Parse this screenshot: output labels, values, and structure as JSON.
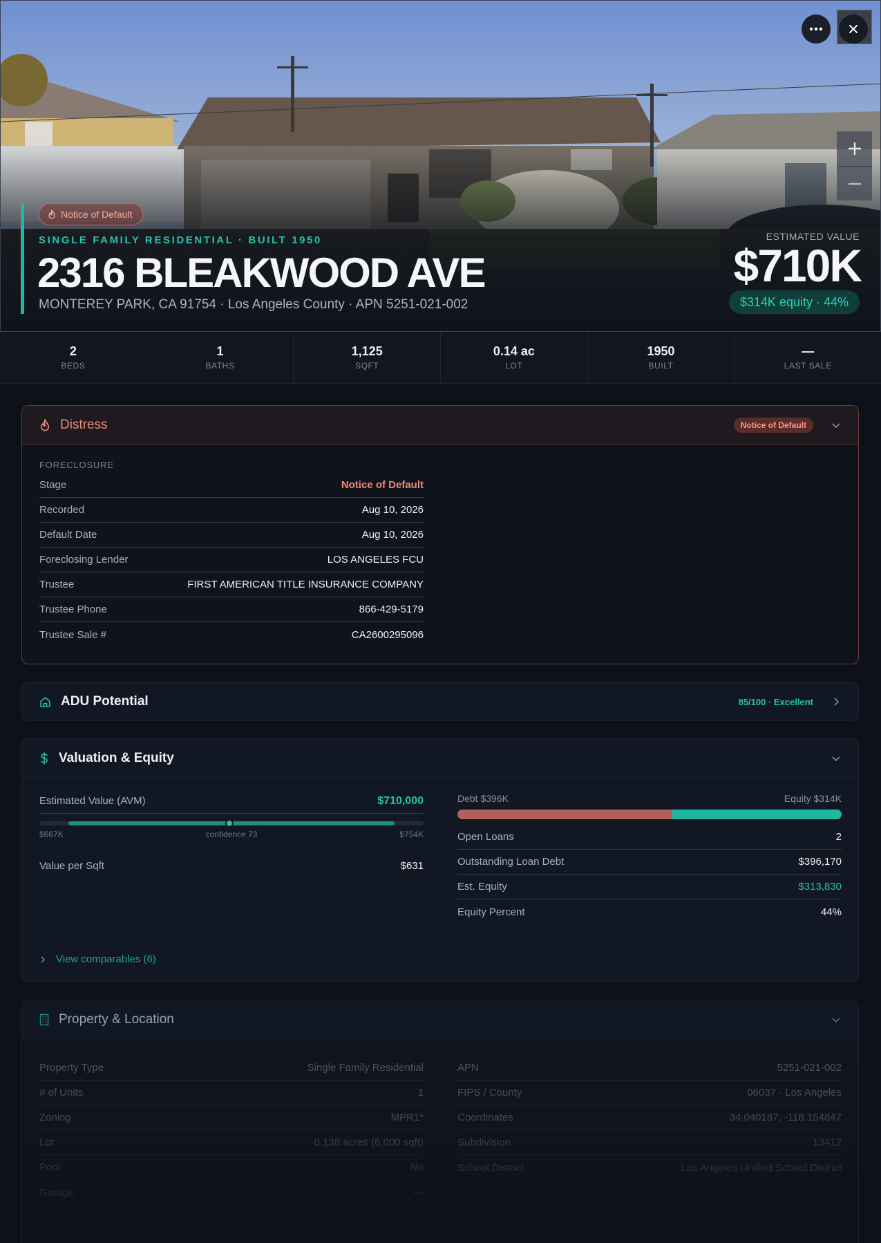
{
  "hero": {
    "badge": "Notice of Default",
    "subtitle": "SINGLE FAMILY RESIDENTIAL · BUILT 1950",
    "address": "2316 BLEAKWOOD AVE",
    "location": "MONTEREY PARK, CA 91754 · Los Angeles County · APN 5251-021-002",
    "estimated_label": "ESTIMATED VALUE",
    "estimated_value": "$710K",
    "equity_pill": "$314K equity · 44%"
  },
  "icons": {
    "more": "more-horizontal-icon",
    "close": "close-icon",
    "zoom_in": "plus-icon",
    "zoom_out": "minus-icon",
    "distress": "flame-icon",
    "adu": "home-icon",
    "valuation": "dollar-icon",
    "property": "building-icon"
  },
  "stats": [
    {
      "value": "2",
      "label": "BEDS"
    },
    {
      "value": "1",
      "label": "BATHS"
    },
    {
      "value": "1,125",
      "label": "SQFT"
    },
    {
      "value": "0.14 ac",
      "label": "LOT"
    },
    {
      "value": "1950",
      "label": "BUILT"
    },
    {
      "value": "—",
      "label": "LAST SALE"
    }
  ],
  "distress": {
    "title": "Distress",
    "badge": "Notice of Default",
    "section": "FORECLOSURE",
    "rows": [
      {
        "k": "Stage",
        "v": "Notice of Default"
      },
      {
        "k": "Recorded",
        "v": "Aug 10, 2026"
      },
      {
        "k": "Default Date",
        "v": "Aug 10, 2026"
      },
      {
        "k": "Foreclosing Lender",
        "v": "LOS ANGELES FCU"
      },
      {
        "k": "Trustee",
        "v": "FIRST AMERICAN TITLE INSURANCE COMPANY"
      },
      {
        "k": "Trustee Phone",
        "v": "866-429-5179"
      },
      {
        "k": "Trustee Sale #",
        "v": "CA2600295096"
      }
    ]
  },
  "adu": {
    "title": "ADU Potential",
    "score": "85/100 · Excellent"
  },
  "valuation": {
    "title": "Valuation & Equity",
    "avm_label": "Estimated Value (AVM)",
    "avm_value": "$710,000",
    "range_low": "$667K",
    "range_high": "$754K",
    "confidence": "confidence 73",
    "range_low_num": 667,
    "range_high_num": 754,
    "avm_num": 710,
    "per_sqft_label": "Value per Sqft",
    "per_sqft_value": "$631",
    "debt_label": "Debt $396K",
    "equity_label": "Equity $314K",
    "debt_share": 0.56,
    "rows": [
      {
        "k": "Open Loans",
        "v": "2"
      },
      {
        "k": "Outstanding Loan Debt",
        "v": "$396,170"
      },
      {
        "k": "Est. Equity",
        "v": "$313,830"
      },
      {
        "k": "Equity Percent",
        "v": "44%"
      }
    ],
    "comparables": "View comparables (6)"
  },
  "property": {
    "title": "Property & Location",
    "left": [
      {
        "k": "Property Type",
        "v": "Single Family Residential"
      },
      {
        "k": "# of Units",
        "v": "1"
      },
      {
        "k": "Zoning",
        "v": "MPR1*"
      },
      {
        "k": "Lot",
        "v": "0.138 acres (6,000 sqft)"
      },
      {
        "k": "Pool",
        "v": "No"
      },
      {
        "k": "Garage",
        "v": "—"
      }
    ],
    "right": [
      {
        "k": "APN",
        "v": "5251-021-002"
      },
      {
        "k": "FIPS / County",
        "v": "06037 · Los Angeles"
      },
      {
        "k": "Coordinates",
        "v": "34.040187, -118.154847"
      },
      {
        "k": "Subdivision",
        "v": "13412"
      },
      {
        "k": "School District",
        "v": "Los Angeles Unified School District"
      }
    ]
  }
}
